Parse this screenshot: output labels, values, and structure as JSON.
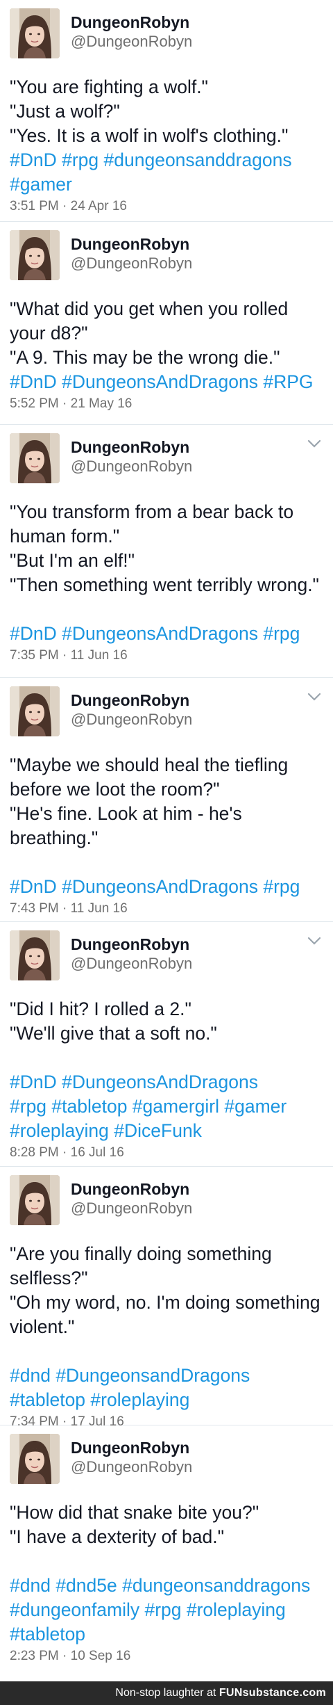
{
  "tweets": [
    {
      "display_name": "DungeonRobyn",
      "handle": "@DungeonRobyn",
      "lines": [
        "\"You are fighting a wolf.\"",
        "\"Just a wolf?\"",
        "\"Yes. It is a wolf in wolf's clothing.\""
      ],
      "hashtags": [
        "#DnD #rpg #dungeonsanddragons",
        "#gamer"
      ],
      "timestamp": "3:51 PM · 24 Apr 16"
    },
    {
      "display_name": "DungeonRobyn",
      "handle": "@DungeonRobyn",
      "lines": [
        "\"What did you get when you rolled",
        "your d8?\"",
        "\"A 9. This may be the wrong die.\""
      ],
      "hashtags": [
        "#DnD #DungeonsAndDragons #RPG"
      ],
      "timestamp": "5:52 PM · 21 May 16"
    },
    {
      "display_name": "DungeonRobyn",
      "handle": "@DungeonRobyn",
      "lines": [
        "\"You transform from a bear back to",
        "human form.\"",
        "\"But I'm an elf!\"",
        "\"Then something went terribly wrong.\""
      ],
      "hashtags": [
        "#DnD #DungeonsAndDragons #rpg"
      ],
      "timestamp": "7:35 PM · 11 Jun 16"
    },
    {
      "display_name": "DungeonRobyn",
      "handle": "@DungeonRobyn",
      "lines": [
        "\"Maybe we should heal the tiefling",
        "before we loot the room?\"",
        "\"He's fine. Look at him - he's",
        "breathing.\""
      ],
      "hashtags": [
        "#DnD #DungeonsAndDragons #rpg"
      ],
      "timestamp": "7:43 PM · 11 Jun 16"
    },
    {
      "display_name": "DungeonRobyn",
      "handle": "@DungeonRobyn",
      "lines": [
        "\"Did I hit? I rolled a 2.\"",
        "\"We'll give that a soft no.\""
      ],
      "hashtags": [
        "#DnD #DungeonsAndDragons",
        "#rpg #tabletop #gamergirl #gamer",
        "#roleplaying #DiceFunk"
      ],
      "timestamp": "8:28 PM · 16 Jul 16"
    },
    {
      "display_name": "DungeonRobyn",
      "handle": "@DungeonRobyn",
      "lines": [
        "\"Are you finally doing something",
        "selfless?\"",
        "\"Oh my word, no. I'm doing something",
        "violent.\""
      ],
      "hashtags": [
        "#dnd #DungeonsandDragons",
        "#tabletop #roleplaying"
      ],
      "timestamp": "7:34 PM · 17 Jul 16"
    },
    {
      "display_name": "DungeonRobyn",
      "handle": "@DungeonRobyn",
      "lines": [
        "\"How did that snake bite you?\"",
        "\"I have a dexterity of bad.\""
      ],
      "hashtags": [
        "#dnd #dnd5e #dungeonsanddragons",
        "#dungeonfamily #rpg #roleplaying",
        "#tabletop"
      ],
      "timestamp": "2:23 PM · 10 Sep 16"
    }
  ],
  "footer": {
    "text": "Non-stop laughter at",
    "brand": "FUNsubstance.com"
  }
}
